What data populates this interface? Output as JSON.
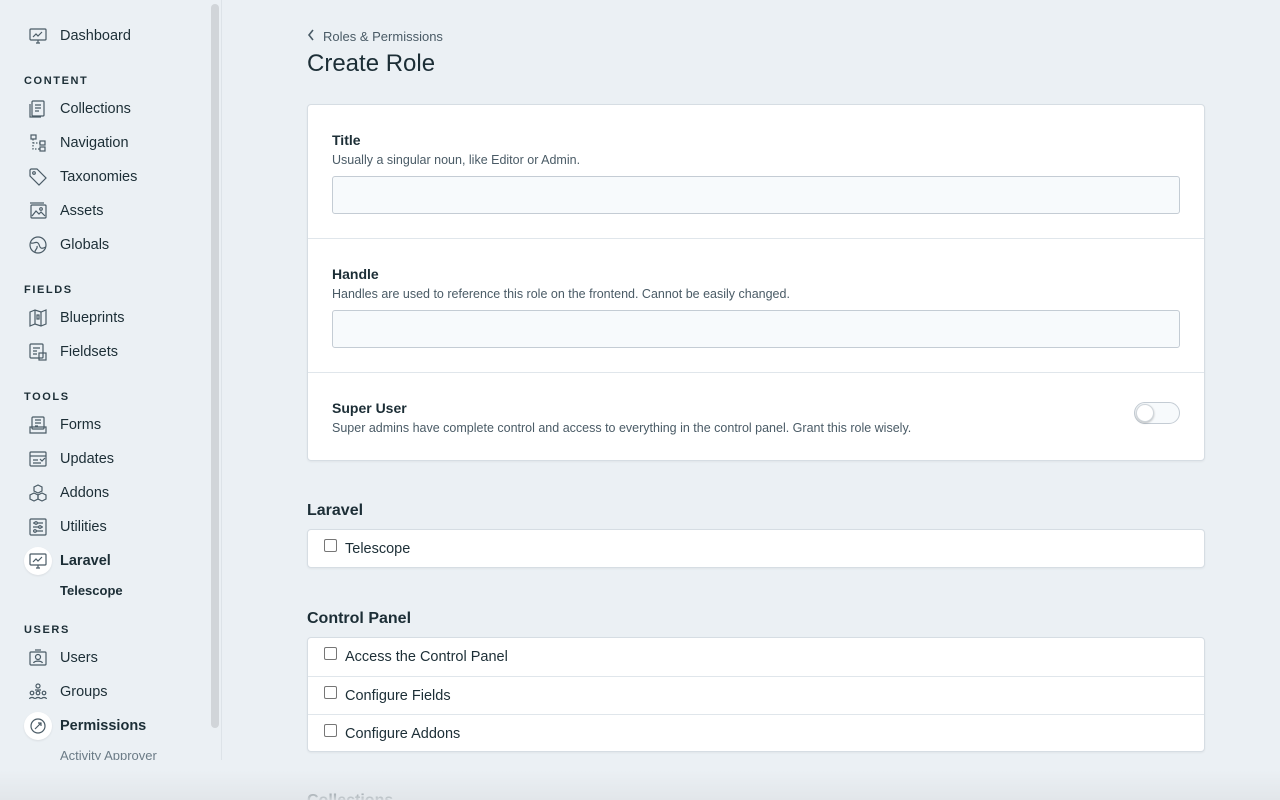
{
  "sidebar": {
    "dashboard": "Dashboard",
    "sections": {
      "content": "CONTENT",
      "fields": "FIELDS",
      "tools": "TOOLS",
      "users": "USERS"
    },
    "content_items": [
      "Collections",
      "Navigation",
      "Taxonomies",
      "Assets",
      "Globals"
    ],
    "fields_items": [
      "Blueprints",
      "Fieldsets"
    ],
    "tools_items": [
      "Forms",
      "Updates",
      "Addons",
      "Utilities",
      "Laravel"
    ],
    "laravel_sub": "Telescope",
    "users_items": [
      "Users",
      "Groups",
      "Permissions"
    ],
    "permissions_sub": "Activity Approver"
  },
  "breadcrumb": "Roles & Permissions",
  "page_title": "Create Role",
  "form": {
    "title_label": "Title",
    "title_help": "Usually a singular noun, like Editor or Admin.",
    "title_value": "",
    "handle_label": "Handle",
    "handle_help": "Handles are used to reference this role on the frontend. Cannot be easily changed.",
    "handle_value": "",
    "super_label": "Super User",
    "super_help": "Super admins have complete control and access to everything in the control panel. Grant this role wisely.",
    "super_enabled": false
  },
  "groups": [
    {
      "title": "Laravel",
      "items": [
        "Telescope"
      ]
    },
    {
      "title": "Control Panel",
      "items": [
        "Access the Control Panel",
        "Configure Fields",
        "Configure Addons"
      ]
    }
  ],
  "next_group_title": "Collections"
}
